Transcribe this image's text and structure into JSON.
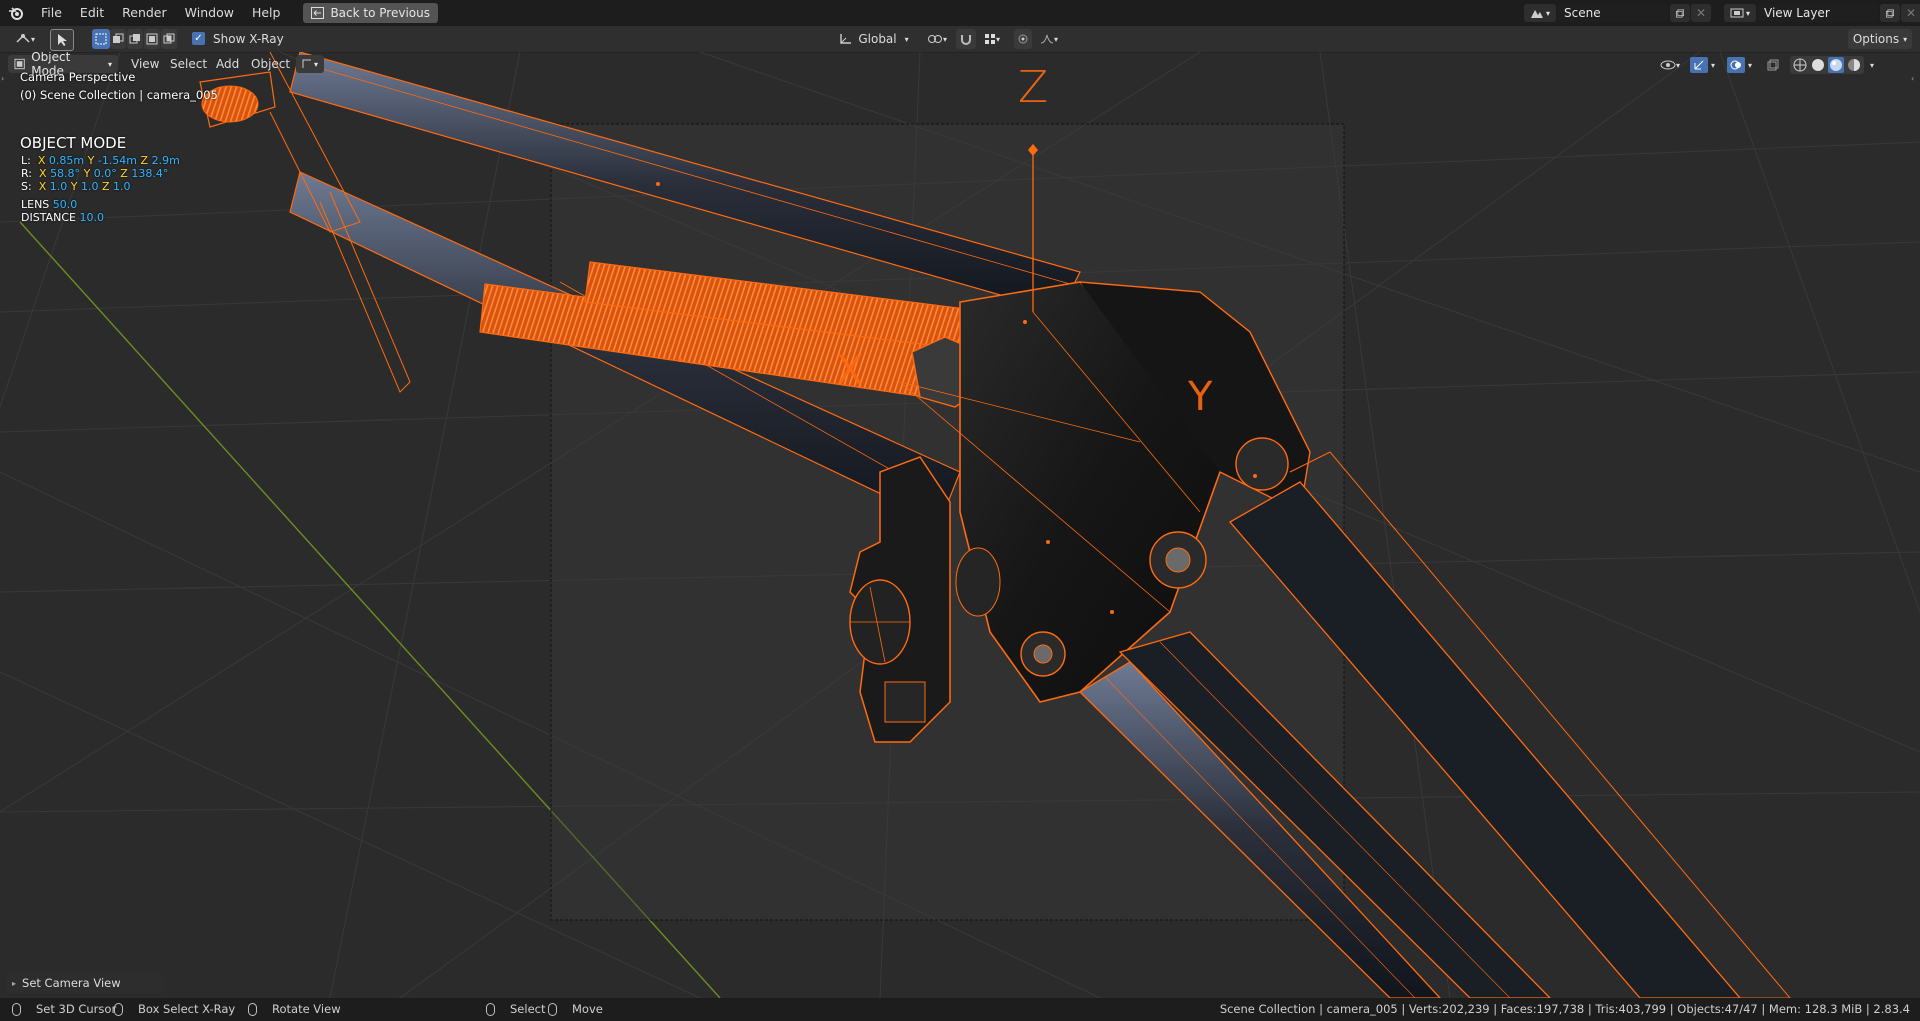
{
  "menubar": {
    "items": [
      "File",
      "Edit",
      "Render",
      "Window",
      "Help"
    ],
    "back_button": "Back to Previous",
    "scene_value": "Scene",
    "view_layer_value": "View Layer"
  },
  "toolbar": {
    "xray_label": "Show X-Ray",
    "xray_checked": true,
    "orientation": "Global",
    "options_label": "Options"
  },
  "header": {
    "mode": "Object Mode",
    "menus": [
      "View",
      "Select",
      "Add",
      "Object"
    ]
  },
  "viewport": {
    "perspective_label": "Camera Perspective",
    "collection_label": "(0) Scene Collection | camera_005",
    "mode_title": "OBJECT MODE",
    "location": {
      "prefix": "L:",
      "x": "0.85m",
      "y": "-1.54m",
      "z": "2.9m"
    },
    "rotation": {
      "prefix": "R:",
      "x": "58.8°",
      "y": "0.0°",
      "z": "138.4°"
    },
    "scale": {
      "prefix": "S:",
      "x": "1.0",
      "y": "1.0",
      "z": "1.0"
    },
    "lens_label": "LENS",
    "lens_value": "50.0",
    "distance_label": "DISTANCE",
    "distance_value": "10.0",
    "axis_labels": {
      "x": "X",
      "y": "Y",
      "z": "Z"
    },
    "operator_panel": "Set Camera View"
  },
  "statusbar": {
    "set_cursor": "Set 3D Cursor",
    "box_select": "Box Select X-Ray",
    "rotate_view": "Rotate View",
    "select": "Select",
    "move": "Move",
    "stats": "Scene Collection | camera_005 | Verts:202,239 | Faces:197,738 | Tris:403,799 | Objects:47/47 | Mem: 128.3 MiB | 2.83.4"
  },
  "colors": {
    "accent": "#4772b3",
    "selection": "#ff6a10",
    "hud_value": "#2fb6ff"
  }
}
